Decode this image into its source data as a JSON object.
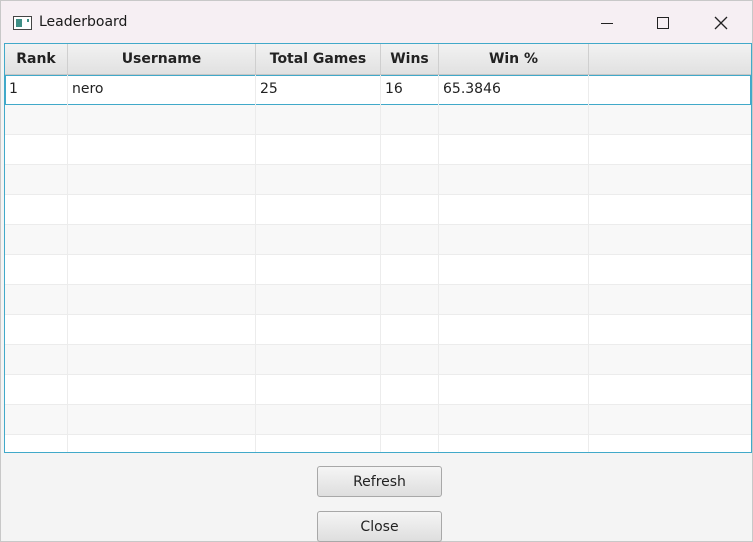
{
  "window": {
    "title": "Leaderboard"
  },
  "table": {
    "columns": [
      "Rank",
      "Username",
      "Total Games",
      "Wins",
      "Win %",
      ""
    ],
    "rows": [
      {
        "rank": "1",
        "username": "nero",
        "total_games": "25",
        "wins": "16",
        "win_pct": "65.3846"
      }
    ]
  },
  "buttons": {
    "refresh": "Refresh",
    "close": "Close"
  },
  "icons": {
    "app": "app-window-icon",
    "minimize": "minimize-icon",
    "maximize": "maximize-icon",
    "close": "close-icon"
  }
}
